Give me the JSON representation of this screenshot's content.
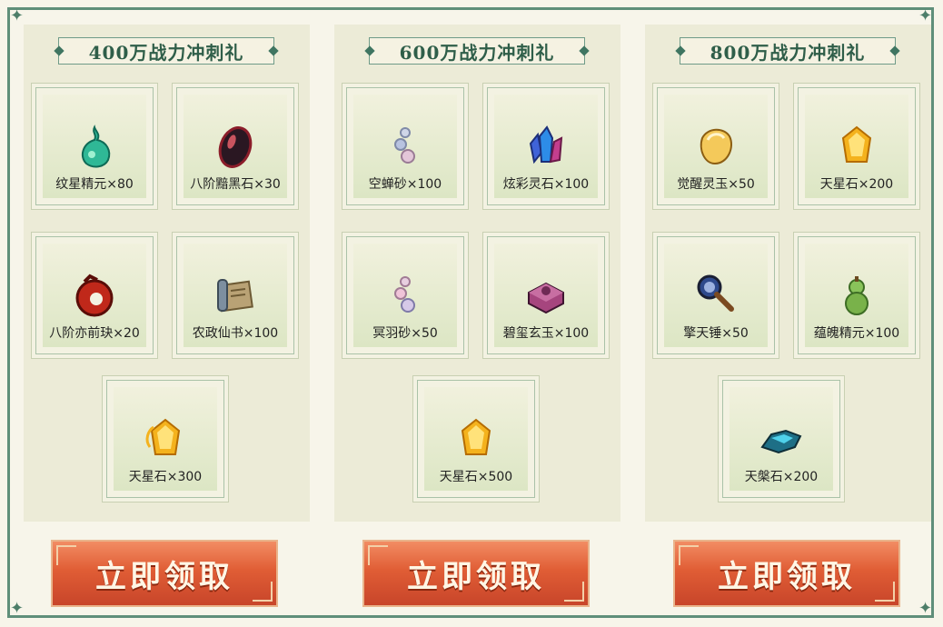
{
  "panels": [
    {
      "title": "400万战力冲刺礼",
      "rewards": [
        {
          "name": "纹星精元×80",
          "icon": "green-flask-icon"
        },
        {
          "name": "八阶黯黑石×30",
          "icon": "dark-stone-icon"
        },
        {
          "name": "八阶亦前玦×20",
          "icon": "red-jade-ring-icon"
        },
        {
          "name": "农政仙书×100",
          "icon": "scroll-book-icon"
        },
        {
          "name": "天星石×300",
          "icon": "gold-star-stone-icon"
        }
      ],
      "button": "立即领取"
    },
    {
      "title": "600万战力冲刺礼",
      "rewards": [
        {
          "name": "空蝉砂×100",
          "icon": "crystal-sand-icon"
        },
        {
          "name": "炫彩灵石×100",
          "icon": "blue-crystal-icon"
        },
        {
          "name": "冥羽砂×50",
          "icon": "pink-sand-icon"
        },
        {
          "name": "碧玺玄玉×100",
          "icon": "purple-jade-box-icon"
        },
        {
          "name": "天星石×500",
          "icon": "gold-star-stone-icon"
        }
      ],
      "button": "立即领取"
    },
    {
      "title": "800万战力冲刺礼",
      "rewards": [
        {
          "name": "觉醒灵玉×50",
          "icon": "amber-jade-icon"
        },
        {
          "name": "天星石×200",
          "icon": "gold-star-stone-icon"
        },
        {
          "name": "擎天锤×50",
          "icon": "hammer-icon"
        },
        {
          "name": "蕴魄精元×100",
          "icon": "green-gourd-icon"
        },
        {
          "name": "天槃石×200",
          "icon": "cyan-ore-icon"
        }
      ],
      "button": "立即领取"
    }
  ]
}
